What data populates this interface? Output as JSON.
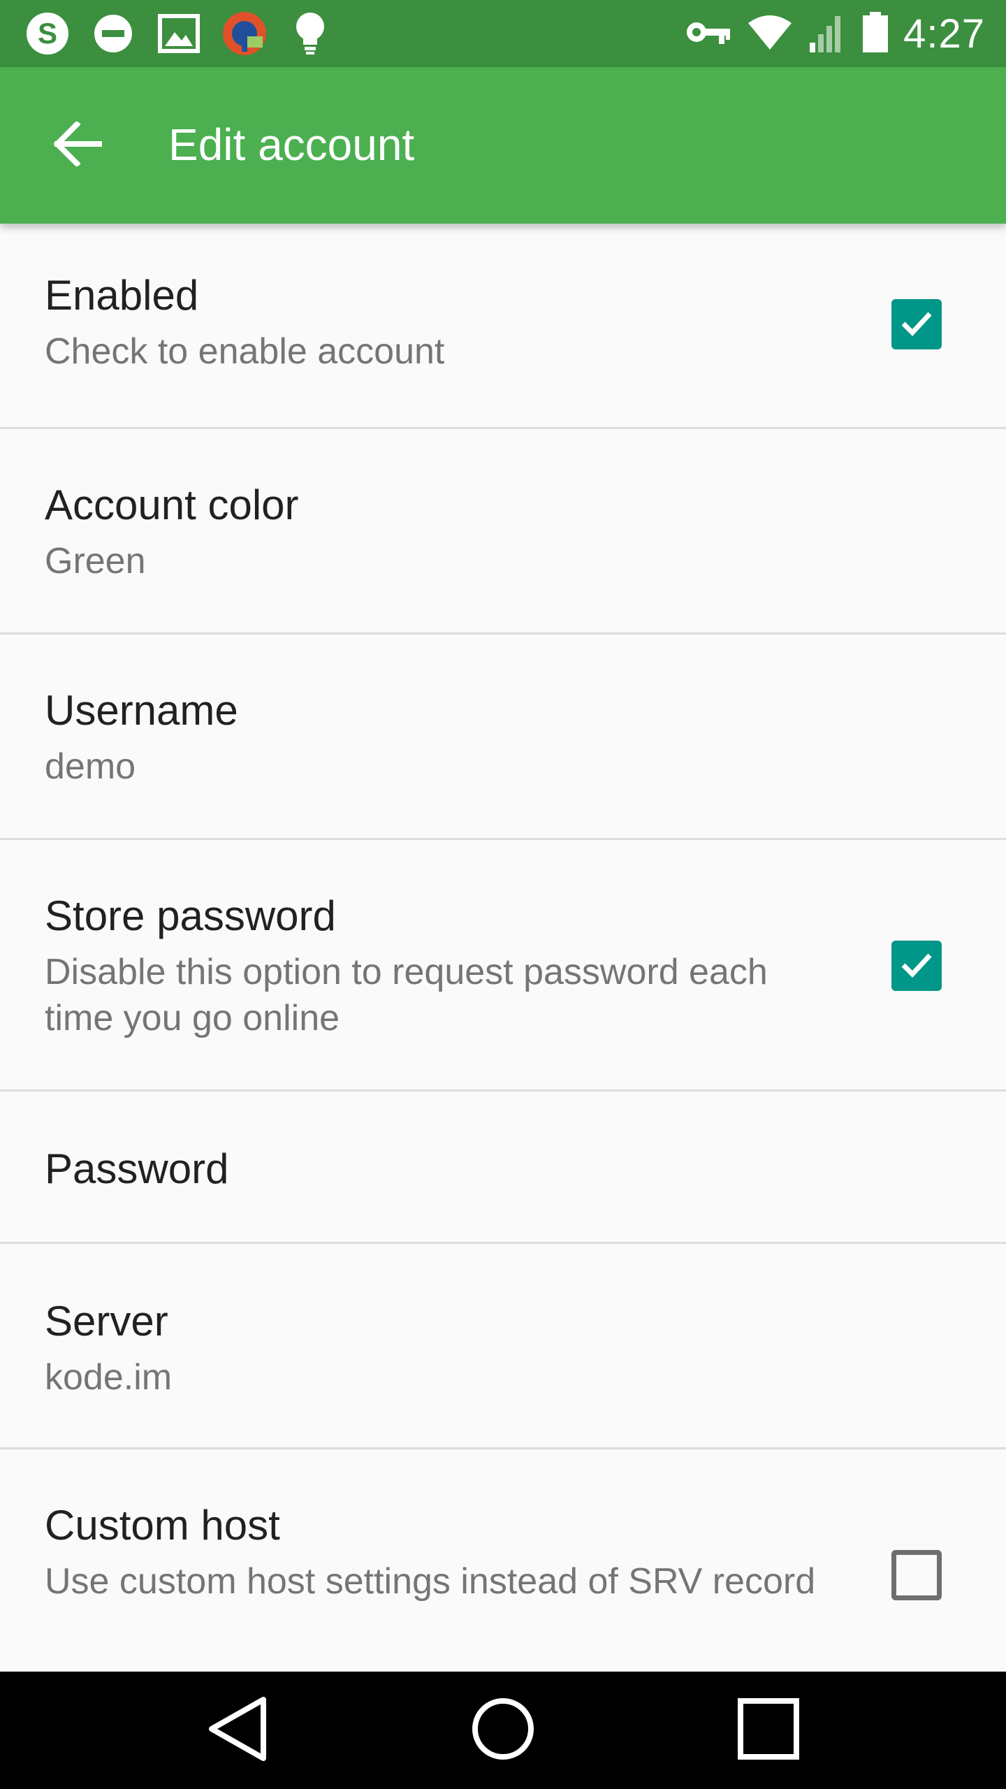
{
  "status_bar": {
    "time": "4:27",
    "left_icons": [
      "skype-icon",
      "do-not-disturb-icon",
      "image-icon",
      "vpn-app-icon",
      "lightbulb-icon"
    ],
    "right_icons": [
      "vpn-key-icon",
      "wifi-icon",
      "signal-icon",
      "battery-icon"
    ]
  },
  "app_bar": {
    "title": "Edit account",
    "back_icon": "arrow-back-icon",
    "background": "#4caf50"
  },
  "preferences": [
    {
      "title": "Enabled",
      "summary": "Check to enable account",
      "checkbox": true
    },
    {
      "title": "Account color",
      "summary": "Green"
    },
    {
      "title": "Username",
      "summary": "demo"
    },
    {
      "title": "Store password",
      "summary": "Disable this option to request password each time you go online",
      "checkbox": true
    },
    {
      "title": "Password"
    },
    {
      "title": "Server",
      "summary": "kode.im"
    },
    {
      "title": "Custom host",
      "summary": "Use custom host settings instead of SRV record",
      "checkbox": false
    }
  ],
  "colors": {
    "accent": "#009688",
    "status_bar": "#3b8f3e"
  },
  "nav_bar": {
    "icons": [
      "back-triangle-icon",
      "home-circle-icon",
      "recents-square-icon"
    ]
  }
}
